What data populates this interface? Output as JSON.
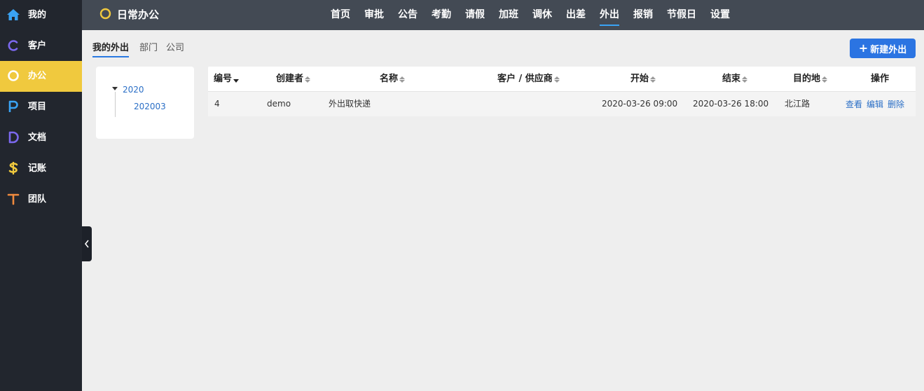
{
  "sidebar": {
    "items": [
      {
        "label": "我的",
        "icon": "home-icon",
        "color": "#3aa3f4"
      },
      {
        "label": "客户",
        "icon": "customer-c-icon",
        "color": "#7b68ee"
      },
      {
        "label": "办公",
        "icon": "office-circle-icon",
        "color": "#ffffff",
        "active": true
      },
      {
        "label": "项目",
        "icon": "project-p-icon",
        "color": "#3aa3f4"
      },
      {
        "label": "文档",
        "icon": "document-d-icon",
        "color": "#7b68ee"
      },
      {
        "label": "记账",
        "icon": "dollar-icon",
        "color": "#f0c93e"
      },
      {
        "label": "团队",
        "icon": "team-t-icon",
        "color": "#f08a3e"
      }
    ],
    "active_color": "#f0c93e"
  },
  "header": {
    "title": "日常办公",
    "nav": [
      "首页",
      "审批",
      "公告",
      "考勤",
      "请假",
      "加班",
      "调休",
      "出差",
      "外出",
      "报销",
      "节假日",
      "设置"
    ],
    "active_nav": "外出"
  },
  "subtabs": [
    "我的外出",
    "部门",
    "公司"
  ],
  "new_button": "新建外出",
  "tree": {
    "root": "2020",
    "child": "202003"
  },
  "table": {
    "columns": [
      "编号",
      "创建者",
      "名称",
      "客户 / 供应商",
      "开始",
      "结束",
      "目的地",
      "操作"
    ],
    "rows": [
      {
        "id": "4",
        "creator": "demo",
        "name": "外出取快递",
        "customer": "",
        "start": "2020-03-26 09:00",
        "end": "2020-03-26 18:00",
        "destination": "北江路",
        "actions": [
          "查看",
          "编辑",
          "删除"
        ]
      }
    ]
  },
  "colors": {
    "sidebar_bg": "#22262e",
    "topbar_bg": "#434a54",
    "accent_blue": "#2b74e2",
    "link_blue": "#2b6fc6"
  }
}
